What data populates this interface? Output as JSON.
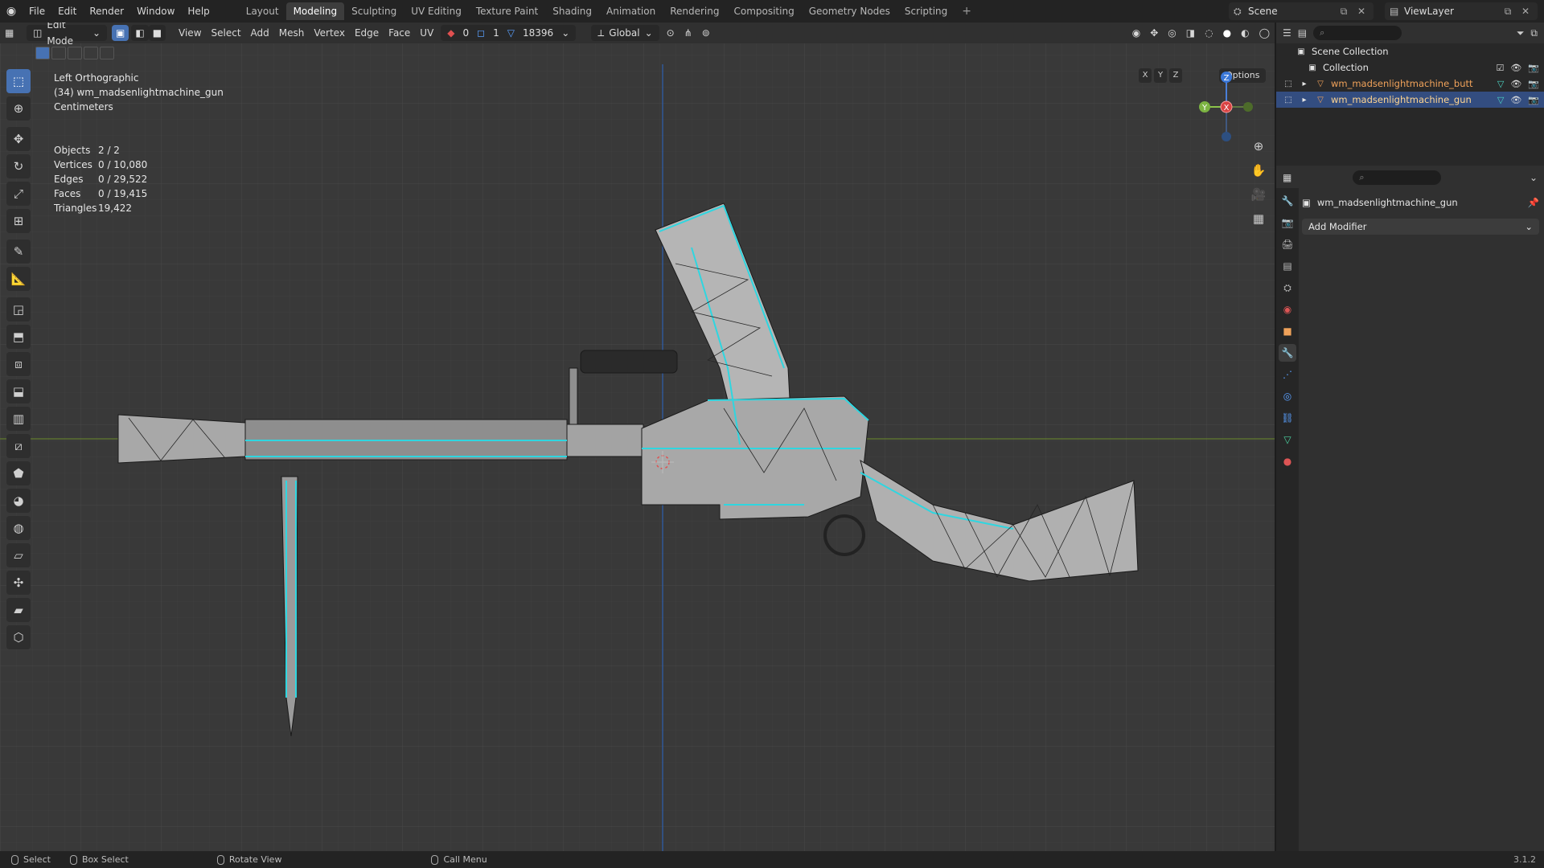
{
  "topbar": {
    "menus": [
      "File",
      "Edit",
      "Render",
      "Window",
      "Help"
    ],
    "workspaces": [
      "Layout",
      "Modeling",
      "Sculpting",
      "UV Editing",
      "Texture Paint",
      "Shading",
      "Animation",
      "Rendering",
      "Compositing",
      "Geometry Nodes",
      "Scripting"
    ],
    "active_workspace": "Modeling",
    "scene": "Scene",
    "view_layer": "ViewLayer"
  },
  "viewport_header": {
    "mode": "Edit Mode",
    "menus": [
      "View",
      "Select",
      "Add",
      "Mesh",
      "Vertex",
      "Edge",
      "Face",
      "UV"
    ],
    "sel_vert": "0",
    "sel_edge": "1",
    "sel_face": "18396",
    "orientation": "Global"
  },
  "overlay": {
    "view": "Left Orthographic",
    "object": "(34) wm_madsenlightmachine_gun",
    "units": "Centimeters",
    "options": "Options"
  },
  "stats": [
    {
      "k": "Objects",
      "v": "2 / 2"
    },
    {
      "k": "Vertices",
      "v": "0 / 10,080"
    },
    {
      "k": "Edges",
      "v": "0 / 29,522"
    },
    {
      "k": "Faces",
      "v": "0 / 19,415"
    },
    {
      "k": "Triangles",
      "v": "19,422"
    }
  ],
  "gizmo": {
    "x": "X",
    "y": "Y",
    "z": "Z"
  },
  "outliner": {
    "root": "Scene Collection",
    "collection": "Collection",
    "objects": [
      "wm_madsenlightmachine_butt",
      "wm_madsenlightmachine_gun"
    ]
  },
  "properties": {
    "object_name": "wm_madsenlightmachine_gun",
    "add_modifier": "Add Modifier"
  },
  "status": {
    "select": "Select",
    "box_select": "Box Select",
    "rotate": "Rotate View",
    "call_menu": "Call Menu",
    "version": "3.1.2"
  }
}
